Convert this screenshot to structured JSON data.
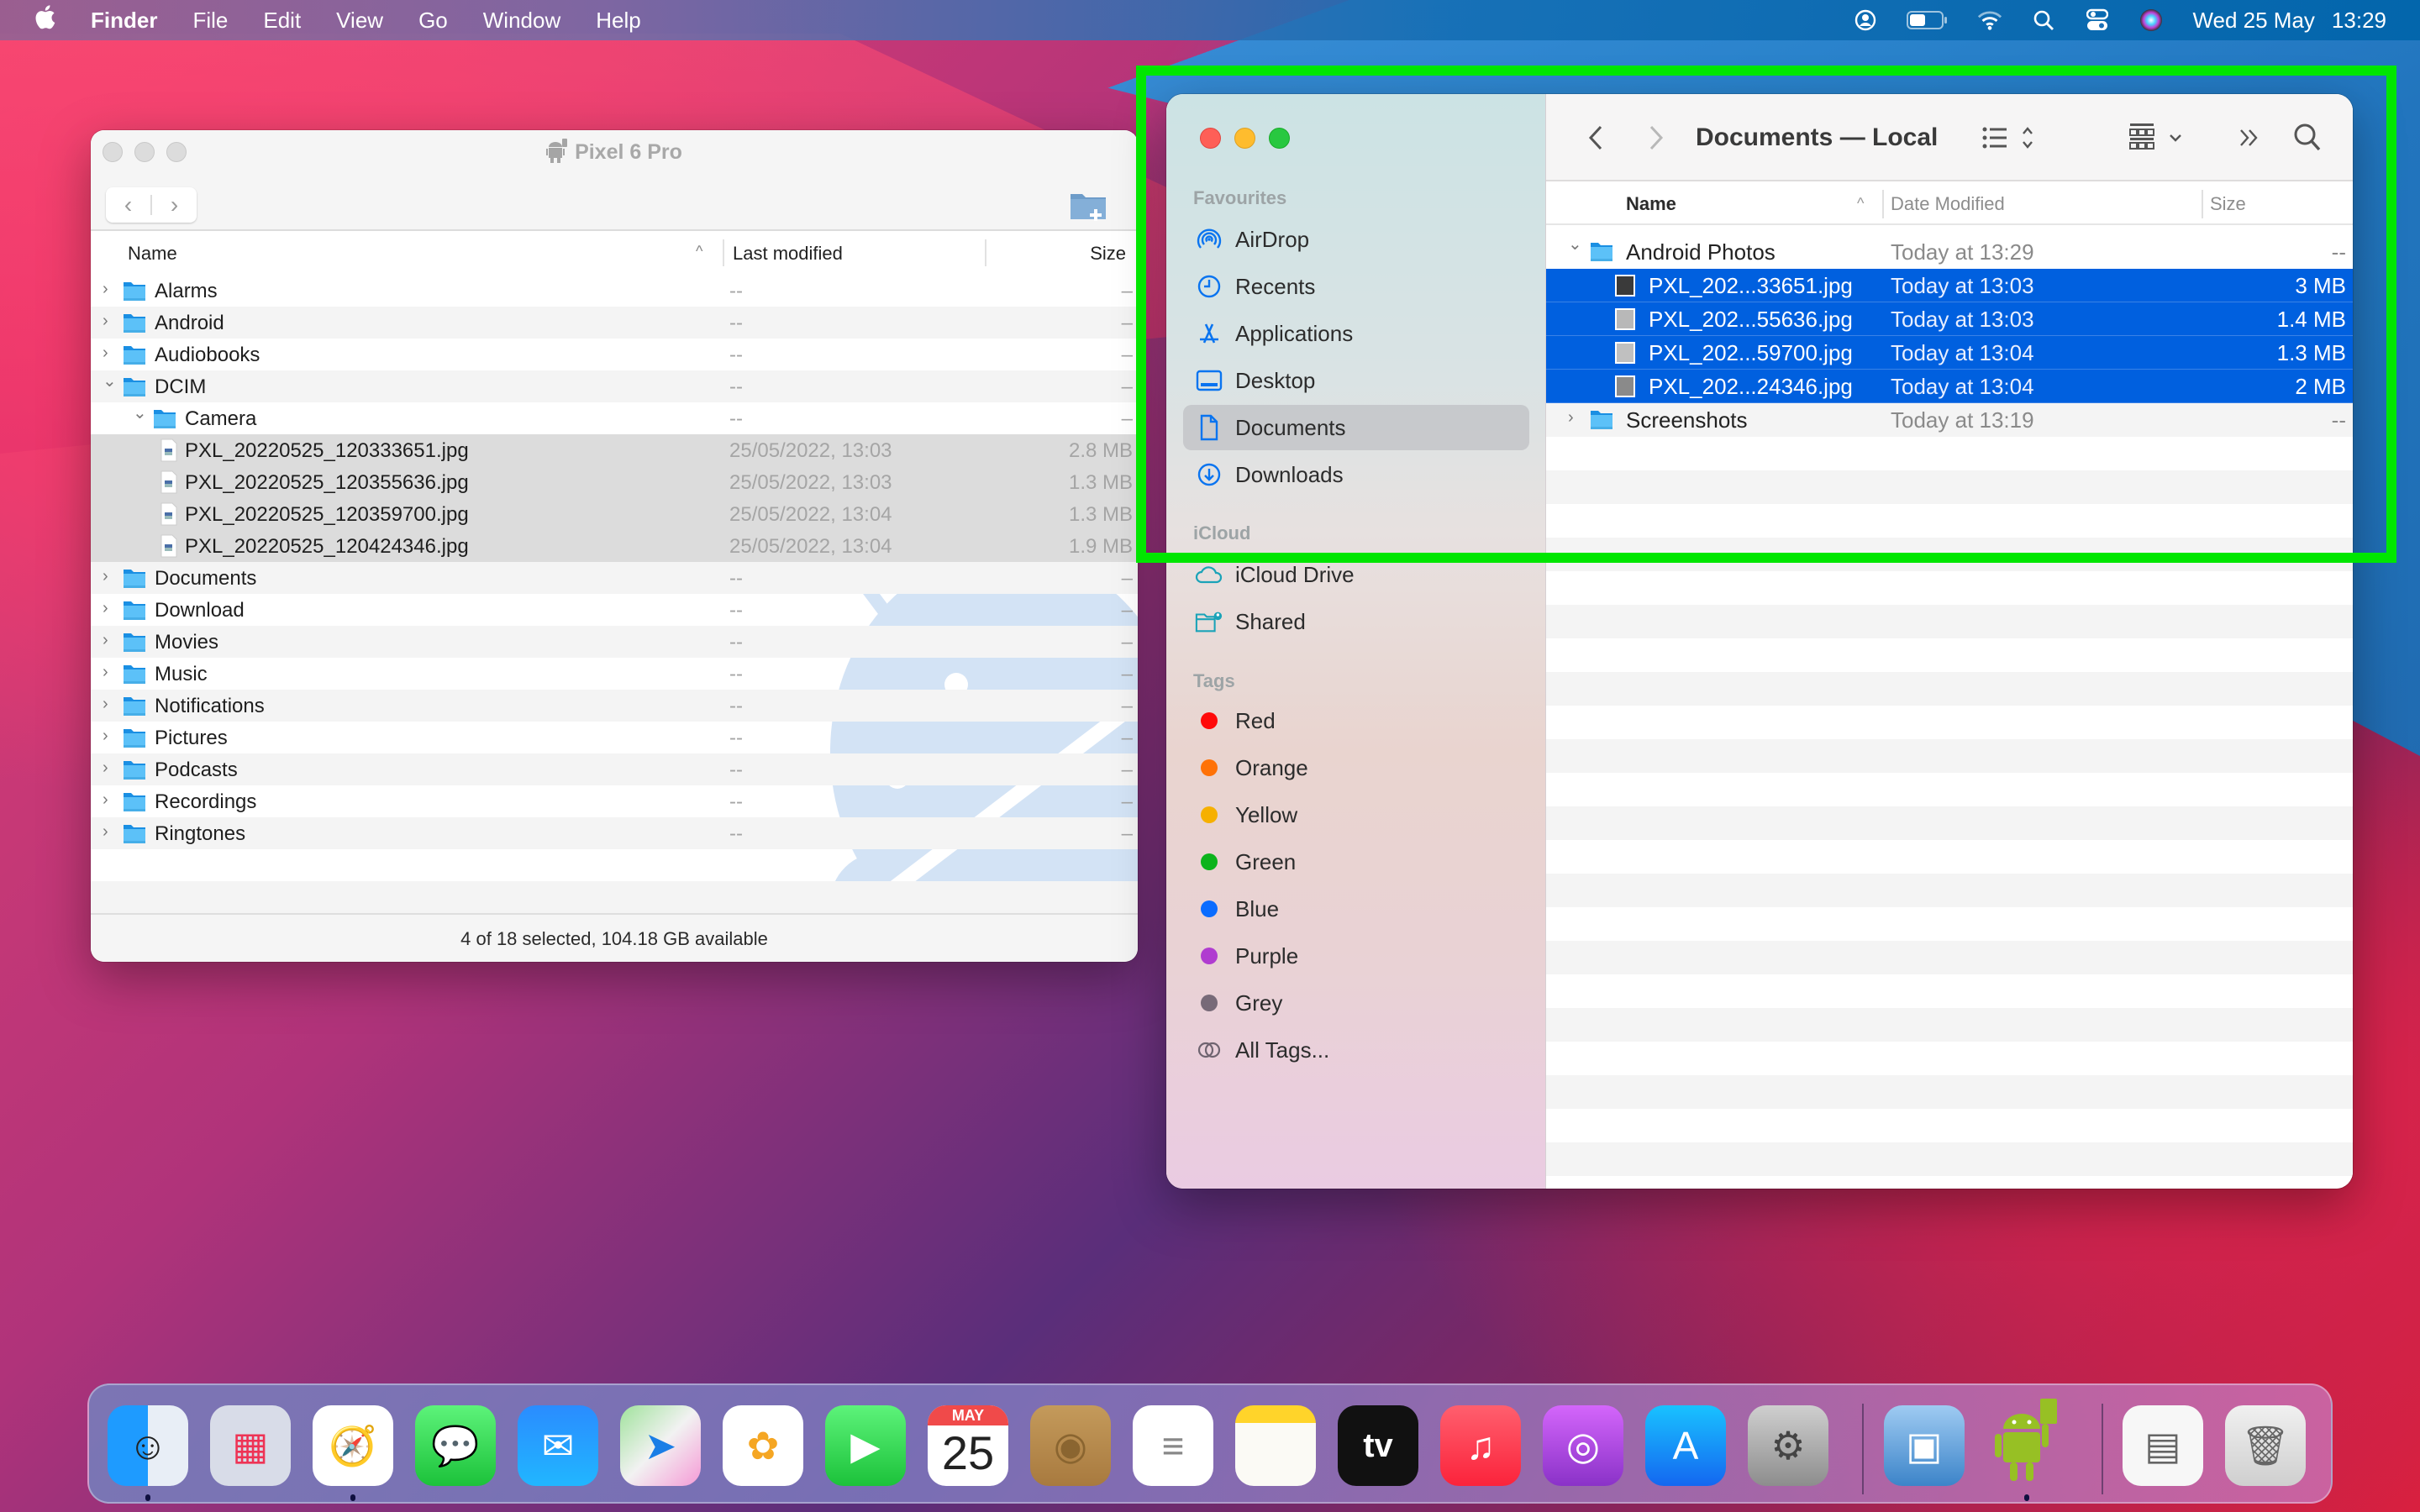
{
  "menubar": {
    "apple_icon": "apple-logo-icon",
    "app_name": "Finder",
    "menus": [
      "File",
      "Edit",
      "View",
      "Go",
      "Window",
      "Help"
    ],
    "status_icons": [
      "user-icon",
      "battery-icon",
      "wifi-icon",
      "spotlight-search-icon",
      "control-center-icon",
      "siri-icon"
    ],
    "date": "Wed 25 May",
    "time": "13:29"
  },
  "android_file_transfer": {
    "title": "Pixel 6 Pro",
    "columns": {
      "name": "Name",
      "last_modified": "Last modified",
      "size": "Size"
    },
    "rows": [
      {
        "name": "Alarms",
        "type": "folder",
        "level": 0,
        "expanded": false,
        "date": "--",
        "size": "–",
        "selected": false
      },
      {
        "name": "Android",
        "type": "folder",
        "level": 0,
        "expanded": false,
        "date": "--",
        "size": "–",
        "selected": false
      },
      {
        "name": "Audiobooks",
        "type": "folder",
        "level": 0,
        "expanded": false,
        "date": "--",
        "size": "–",
        "selected": false
      },
      {
        "name": "DCIM",
        "type": "folder",
        "level": 0,
        "expanded": true,
        "date": "--",
        "size": "–",
        "selected": false
      },
      {
        "name": "Camera",
        "type": "folder",
        "level": 1,
        "expanded": true,
        "date": "--",
        "size": "–",
        "selected": false
      },
      {
        "name": "PXL_20220525_120333651.jpg",
        "type": "file",
        "level": 2,
        "date": "25/05/2022, 13:03",
        "size": "2.8 MB",
        "selected": true
      },
      {
        "name": "PXL_20220525_120355636.jpg",
        "type": "file",
        "level": 2,
        "date": "25/05/2022, 13:03",
        "size": "1.3 MB",
        "selected": true
      },
      {
        "name": "PXL_20220525_120359700.jpg",
        "type": "file",
        "level": 2,
        "date": "25/05/2022, 13:04",
        "size": "1.3 MB",
        "selected": true
      },
      {
        "name": "PXL_20220525_120424346.jpg",
        "type": "file",
        "level": 2,
        "date": "25/05/2022, 13:04",
        "size": "1.9 MB",
        "selected": true
      },
      {
        "name": "Documents",
        "type": "folder",
        "level": 0,
        "expanded": false,
        "date": "--",
        "size": "–",
        "selected": false
      },
      {
        "name": "Download",
        "type": "folder",
        "level": 0,
        "expanded": false,
        "date": "--",
        "size": "–",
        "selected": false
      },
      {
        "name": "Movies",
        "type": "folder",
        "level": 0,
        "expanded": false,
        "date": "--",
        "size": "–",
        "selected": false
      },
      {
        "name": "Music",
        "type": "folder",
        "level": 0,
        "expanded": false,
        "date": "--",
        "size": "–",
        "selected": false
      },
      {
        "name": "Notifications",
        "type": "folder",
        "level": 0,
        "expanded": false,
        "date": "--",
        "size": "–",
        "selected": false
      },
      {
        "name": "Pictures",
        "type": "folder",
        "level": 0,
        "expanded": false,
        "date": "--",
        "size": "–",
        "selected": false
      },
      {
        "name": "Podcasts",
        "type": "folder",
        "level": 0,
        "expanded": false,
        "date": "--",
        "size": "–",
        "selected": false
      },
      {
        "name": "Recordings",
        "type": "folder",
        "level": 0,
        "expanded": false,
        "date": "--",
        "size": "–",
        "selected": false
      },
      {
        "name": "Ringtones",
        "type": "folder",
        "level": 0,
        "expanded": false,
        "date": "--",
        "size": "–",
        "selected": false
      }
    ],
    "status": "4 of 18 selected, 104.18 GB available"
  },
  "finder": {
    "title": "Documents — Local",
    "sidebar": {
      "favourites_heading": "Favourites",
      "favourites": [
        {
          "label": "AirDrop",
          "icon": "airdrop-icon",
          "active": false
        },
        {
          "label": "Recents",
          "icon": "clock-icon",
          "active": false
        },
        {
          "label": "Applications",
          "icon": "applications-icon",
          "active": false
        },
        {
          "label": "Desktop",
          "icon": "desktop-icon",
          "active": false
        },
        {
          "label": "Documents",
          "icon": "document-icon",
          "active": true
        },
        {
          "label": "Downloads",
          "icon": "download-icon",
          "active": false
        }
      ],
      "icloud_heading": "iCloud",
      "icloud": [
        {
          "label": "iCloud Drive",
          "icon": "cloud-icon"
        },
        {
          "label": "Shared",
          "icon": "shared-folder-icon"
        }
      ],
      "tags_heading": "Tags",
      "tags": [
        {
          "label": "Red",
          "color": "#ff0a0a"
        },
        {
          "label": "Orange",
          "color": "#ff7207"
        },
        {
          "label": "Yellow",
          "color": "#f6b000"
        },
        {
          "label": "Green",
          "color": "#0cb31c"
        },
        {
          "label": "Blue",
          "color": "#0a6cff"
        },
        {
          "label": "Purple",
          "color": "#b03cd0"
        },
        {
          "label": "Grey",
          "color": "#776a78"
        }
      ],
      "all_tags": "All Tags..."
    },
    "columns": {
      "name": "Name",
      "date": "Date Modified",
      "size": "Size"
    },
    "rows": [
      {
        "name": "Android Photos",
        "type": "folder",
        "level": 0,
        "expanded": true,
        "date": "Today at 13:29",
        "size": "--",
        "selected": false
      },
      {
        "name": "PXL_202...33651.jpg",
        "type": "image",
        "level": 1,
        "date": "Today at 13:03",
        "size": "3 MB",
        "selected": true
      },
      {
        "name": "PXL_202...55636.jpg",
        "type": "image",
        "level": 1,
        "date": "Today at 13:03",
        "size": "1.4 MB",
        "selected": true
      },
      {
        "name": "PXL_202...59700.jpg",
        "type": "image",
        "level": 1,
        "date": "Today at 13:04",
        "size": "1.3 MB",
        "selected": true
      },
      {
        "name": "PXL_202...24346.jpg",
        "type": "image",
        "level": 1,
        "date": "Today at 13:04",
        "size": "2 MB",
        "selected": true
      },
      {
        "name": "Screenshots",
        "type": "folder",
        "level": 0,
        "expanded": false,
        "date": "Today at 13:19",
        "size": "--",
        "selected": false
      }
    ],
    "colors": {
      "selection": "#0060df"
    }
  },
  "dock": {
    "apps": [
      {
        "name": "Finder",
        "running": true
      },
      {
        "name": "Launchpad",
        "running": false
      },
      {
        "name": "Safari",
        "running": true
      },
      {
        "name": "Messages",
        "running": false
      },
      {
        "name": "Mail",
        "running": false
      },
      {
        "name": "Maps",
        "running": false
      },
      {
        "name": "Photos",
        "running": false
      },
      {
        "name": "FaceTime",
        "running": false
      },
      {
        "name": "Calendar",
        "running": false,
        "month": "MAY",
        "day": "25"
      },
      {
        "name": "Contacts",
        "running": false
      },
      {
        "name": "Reminders",
        "running": false
      },
      {
        "name": "Notes",
        "running": false
      },
      {
        "name": "TV",
        "running": false,
        "label": "tv"
      },
      {
        "name": "Music",
        "running": false
      },
      {
        "name": "Podcasts",
        "running": false
      },
      {
        "name": "App Store",
        "running": false
      },
      {
        "name": "System Preferences",
        "running": false
      },
      {
        "name": "Preview",
        "running": false
      },
      {
        "name": "Android File Transfer",
        "running": true
      },
      {
        "name": "Disk Image",
        "running": false
      },
      {
        "name": "Trash",
        "running": false
      }
    ]
  },
  "annotation": {
    "highlight_color": "#00e600"
  }
}
